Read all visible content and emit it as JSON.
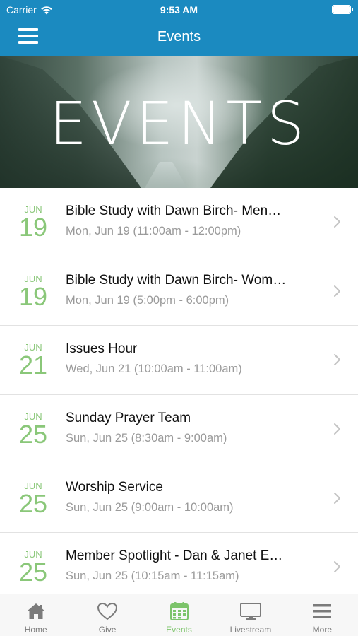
{
  "status_bar": {
    "carrier": "Carrier",
    "time": "9:53 AM"
  },
  "nav": {
    "title": "Events"
  },
  "hero": {
    "title": "EVENTS"
  },
  "events": [
    {
      "month": "JUN",
      "day": "19",
      "name": "Bible Study with Dawn Birch- Men…",
      "when": "Mon, Jun 19 (11:00am - 12:00pm)"
    },
    {
      "month": "JUN",
      "day": "19",
      "name": "Bible Study with Dawn Birch- Wom…",
      "when": "Mon, Jun 19 (5:00pm - 6:00pm)"
    },
    {
      "month": "JUN",
      "day": "21",
      "name": "Issues Hour",
      "when": "Wed, Jun 21 (10:00am - 11:00am)"
    },
    {
      "month": "JUN",
      "day": "25",
      "name": "Sunday Prayer Team",
      "when": "Sun, Jun 25 (8:30am - 9:00am)"
    },
    {
      "month": "JUN",
      "day": "25",
      "name": "Worship Service",
      "when": "Sun, Jun 25 (9:00am - 10:00am)"
    },
    {
      "month": "JUN",
      "day": "25",
      "name": "Member Spotlight - Dan & Janet E…",
      "when": "Sun, Jun 25 (10:15am - 11:15am)"
    }
  ],
  "tabs": [
    {
      "label": "Home",
      "icon": "home-icon",
      "active": false
    },
    {
      "label": "Give",
      "icon": "heart-icon",
      "active": false
    },
    {
      "label": "Events",
      "icon": "calendar-icon",
      "active": true
    },
    {
      "label": "Livestream",
      "icon": "monitor-icon",
      "active": false
    },
    {
      "label": "More",
      "icon": "more-icon",
      "active": false
    }
  ],
  "colors": {
    "brand": "#1b8ac0",
    "accent": "#7dc46b",
    "date": "#8ac779"
  }
}
